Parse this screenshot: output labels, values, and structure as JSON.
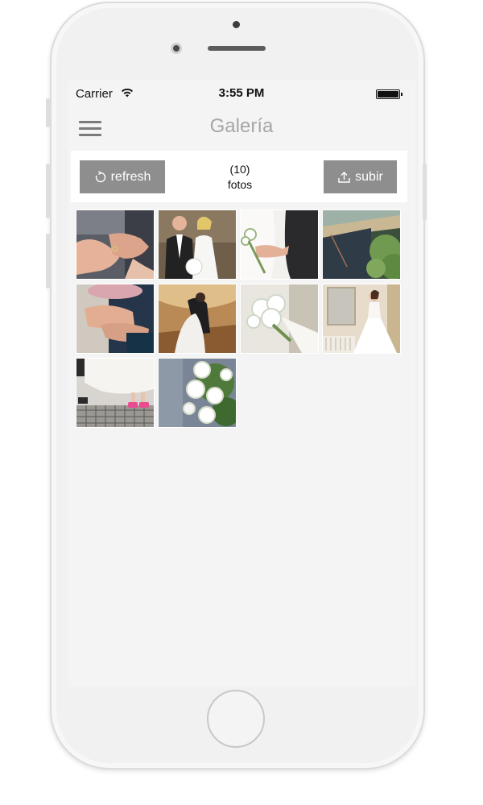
{
  "status_bar": {
    "carrier": "Carrier",
    "time": "3:55 PM",
    "icons": [
      "wifi-icon",
      "battery-icon"
    ]
  },
  "nav": {
    "title": "Galería",
    "menu_icon": "hamburger-menu-icon"
  },
  "toolbar": {
    "refresh_label": "refresh",
    "refresh_icon": "refresh-icon",
    "count": "(10)",
    "count_label": "fotos",
    "upload_label": "subir",
    "upload_icon": "upload-icon"
  },
  "gallery": {
    "photos": [
      {
        "subject": "hands-with-rings"
      },
      {
        "subject": "bride-and-groom-portrait"
      },
      {
        "subject": "couple-holding-hands-with-bouquet"
      },
      {
        "subject": "outdoor-scene-with-trees"
      },
      {
        "subject": "hands-with-bouquet"
      },
      {
        "subject": "couple-kissing-on-bridge"
      },
      {
        "subject": "white-flower-bouquet"
      },
      {
        "subject": "bride-in-room"
      },
      {
        "subject": "bride-dress-with-pink-sneakers"
      },
      {
        "subject": "white-roses-bouquet-closeup"
      }
    ]
  },
  "colors": {
    "button_bg": "#8e8e8e",
    "title_text": "#a6a6a6",
    "screen_bg": "#f4f4f4"
  }
}
